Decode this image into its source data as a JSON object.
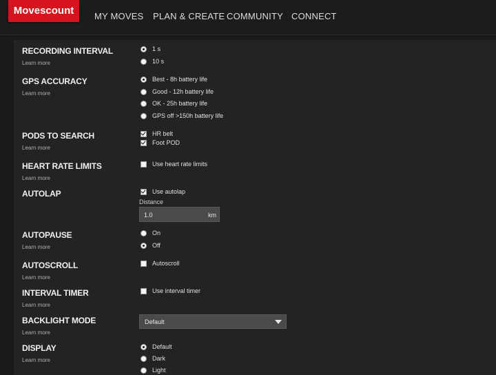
{
  "header": {
    "logo": "Movescount",
    "nav": [
      "MY MOVES",
      "PLAN & CREATE",
      "COMMUNITY",
      "CONNECT"
    ]
  },
  "learn_more": "Learn more",
  "recording_interval": {
    "title": "RECORDING INTERVAL",
    "options": [
      "1 s",
      "10 s"
    ],
    "selected": "1 s"
  },
  "gps_accuracy": {
    "title": "GPS ACCURACY",
    "options": [
      "Best - 8h battery life",
      "Good - 12h battery life",
      "OK - 25h battery life",
      "GPS off >150h battery life"
    ],
    "selected": "Best - 8h battery life"
  },
  "pods": {
    "title": "PODS TO SEARCH",
    "options": [
      "HR belt",
      "Foot POD"
    ],
    "checked": [
      true,
      true
    ]
  },
  "heart_rate": {
    "title": "HEART RATE LIMITS",
    "option": "Use heart rate limits",
    "checked": false
  },
  "autolap": {
    "title": "AUTOLAP",
    "option": "Use autolap",
    "checked": true,
    "distance_label": "Distance",
    "distance_value": "1.0",
    "distance_unit": "km"
  },
  "autopause": {
    "title": "AUTOPAUSE",
    "options": [
      "On",
      "Off"
    ],
    "selected": "Off"
  },
  "autoscroll": {
    "title": "AUTOSCROLL",
    "option": "Autoscroll",
    "checked": false
  },
  "interval_timer": {
    "title": "INTERVAL TIMER",
    "option": "Use interval timer",
    "checked": false
  },
  "backlight": {
    "title": "BACKLIGHT MODE",
    "value": "Default"
  },
  "display": {
    "title": "DISPLAY",
    "options": [
      "Default",
      "Dark",
      "Light"
    ],
    "selected": "Default"
  }
}
